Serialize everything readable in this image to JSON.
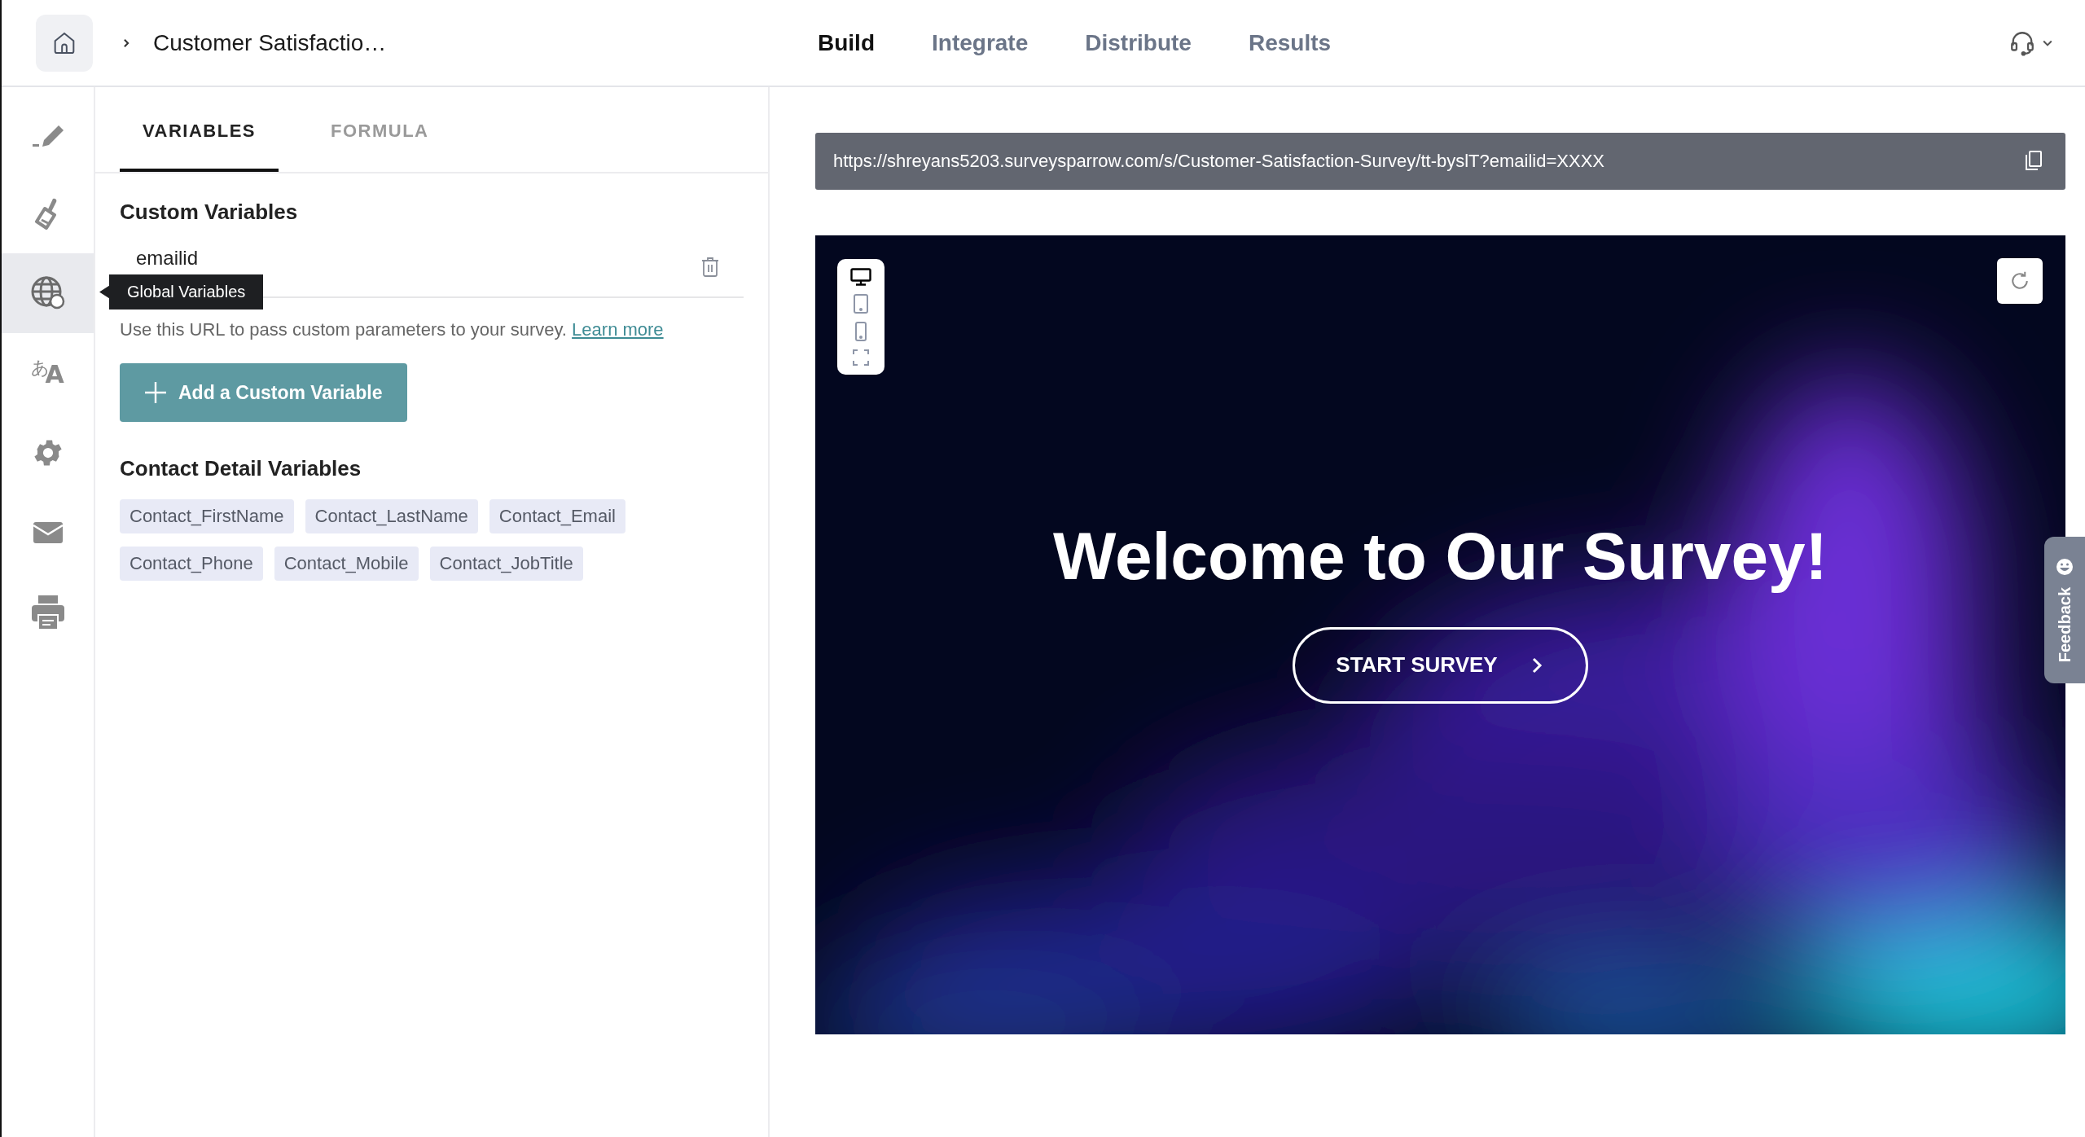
{
  "header": {
    "survey_title": "Customer Satisfactio…",
    "nav_tabs": [
      {
        "label": "Build",
        "selected": true
      },
      {
        "label": "Integrate",
        "selected": false
      },
      {
        "label": "Distribute",
        "selected": false
      },
      {
        "label": "Results",
        "selected": false
      }
    ]
  },
  "sidebar": {
    "items": [
      {
        "kind": "pen",
        "selected": false
      },
      {
        "kind": "brush",
        "selected": false
      },
      {
        "kind": "globe",
        "selected": true
      },
      {
        "kind": "translate",
        "glyph_small": "あ",
        "glyph_large": "A",
        "selected": false
      },
      {
        "kind": "gear",
        "selected": false
      },
      {
        "kind": "mail",
        "selected": false
      },
      {
        "kind": "printer",
        "selected": false
      }
    ],
    "tooltip": "Global Variables"
  },
  "panel": {
    "tabs": [
      {
        "label": "VARIABLES",
        "selected": true
      },
      {
        "label": "FORMULA",
        "selected": false
      }
    ],
    "custom_variables": {
      "heading": "Custom Variables",
      "variables": [
        {
          "value": "emailid"
        }
      ],
      "help_text": "Use this URL to pass custom parameters to your survey.",
      "help_link": "Learn more",
      "add_button": "Add a Custom Variable"
    },
    "contact_details": {
      "heading": "Contact Detail Variables",
      "tags": [
        "Contact_FirstName",
        "Contact_LastName",
        "Contact_Email",
        "Contact_Phone",
        "Contact_Mobile",
        "Contact_JobTitle"
      ]
    }
  },
  "preview": {
    "url": "https://shreyans5203.surveysparrow.com/s/Customer-Satisfaction-Survey/tt-byslT?emailid=XXXX",
    "devices": [
      {
        "kind": "desktop",
        "selected": true
      },
      {
        "kind": "tablet",
        "selected": false
      },
      {
        "kind": "phone",
        "selected": false
      },
      {
        "kind": "fullscreen",
        "selected": false
      }
    ],
    "welcome_title": "Welcome to Our Survey!",
    "start_button": "START SURVEY"
  },
  "feedback_tab": "Feedback"
}
